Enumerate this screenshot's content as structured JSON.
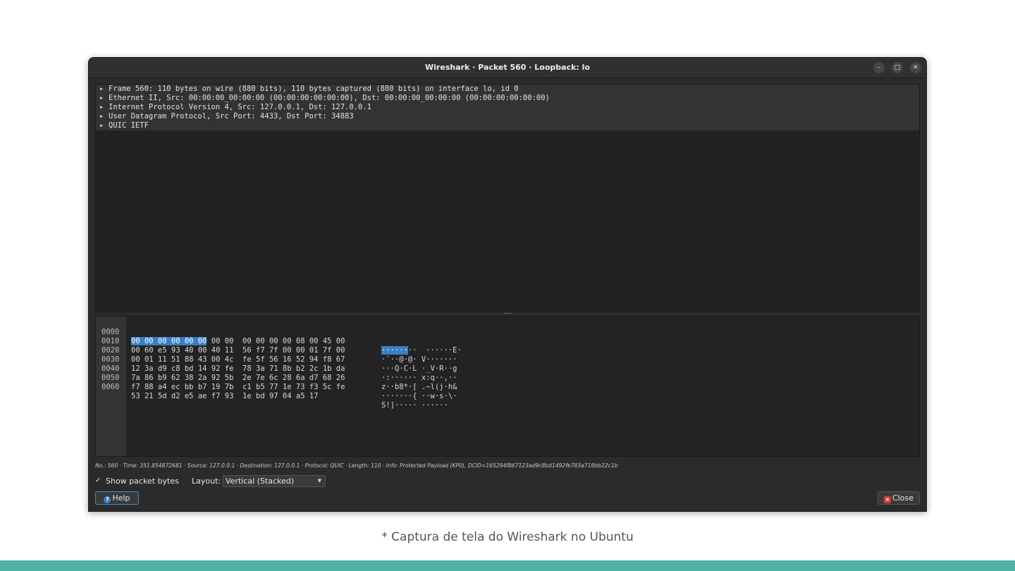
{
  "window": {
    "title": "Wireshark · Packet 560 · Loopback: lo",
    "controls": {
      "minimize": "–",
      "maximize": "□",
      "close": "✕"
    }
  },
  "tree": {
    "rows": [
      {
        "text": "Frame 560: 110 bytes on wire (880 bits), 110 bytes captured (880 bits) on interface lo, id 0"
      },
      {
        "text": "Ethernet II, Src: 00:00:00_00:00:00 (00:00:00:00:00:00), Dst: 00:00:00_00:00:00 (00:00:00:00:00:00)"
      },
      {
        "text": "Internet Protocol Version 4, Src: 127.0.0.1, Dst: 127.0.0.1"
      },
      {
        "text": "User Datagram Protocol, Src Port: 4433, Dst Port: 34883"
      },
      {
        "text": "QUIC IETF"
      }
    ]
  },
  "hex": {
    "lines": [
      {
        "offset": "0000",
        "hl_bytes": "00 00 00 00 00 00",
        "bytes": " 00 00  00 00 00 00 08 00 45 00",
        "hl_ascii": "······",
        "ascii": "··  ······E·"
      },
      {
        "offset": "0010",
        "hl_bytes": "",
        "bytes": "00 60 e5 93 40 00 40 11  56 f7 7f 00 00 01 7f 00",
        "hl_ascii": "",
        "ascii": "·`··@·@· V·······"
      },
      {
        "offset": "0020",
        "hl_bytes": "",
        "bytes": "00 01 11 51 88 43 00 4c  fe 5f 56 16 52 94 f8 67",
        "hl_ascii": "",
        "ascii": "···Q·C·L ·_V·R··g"
      },
      {
        "offset": "0030",
        "hl_bytes": "",
        "bytes": "12 3a d9 c8 bd 14 92 fe  78 3a 71 8b b2 2c 1b da",
        "hl_ascii": "",
        "ascii": "·:······ x:q··,··"
      },
      {
        "offset": "0040",
        "hl_bytes": "",
        "bytes": "7a 86 b9 62 38 2a 92 5b  2e 7e 6c 28 6a d7 68 26",
        "hl_ascii": "",
        "ascii": "z··b8*·[ .~l(j·h&"
      },
      {
        "offset": "0050",
        "hl_bytes": "",
        "bytes": "f7 88 a4 ec bb b7 19 7b  c1 b5 77 1e 73 f3 5c fe",
        "hl_ascii": "",
        "ascii": "·······{ ··w·s·\\·"
      },
      {
        "offset": "0060",
        "hl_bytes": "",
        "bytes": "53 21 5d d2 e5 ae f7 93  1e bd 97 04 a5 17",
        "hl_ascii": "",
        "ascii": "S!]····· ······"
      }
    ]
  },
  "status": {
    "text": "No.: 560 · Time: 351.854872681 · Source: 127.0.0.1 · Destination: 127.0.0.1 · Protocol: QUIC · Length: 110 · Info: Protected Payload (KP0), DCID=165294f867123ad9c8bd1492fe783a718bb22c1b"
  },
  "options": {
    "show_bytes_check": "✓",
    "show_bytes_label": "Show packet bytes",
    "layout_label": "Layout:",
    "layout_value": "Vertical (Stacked)"
  },
  "buttons": {
    "help_icon": "?",
    "help_label": "Help",
    "close_icon": "×",
    "close_label": "Close"
  },
  "caption": "* Captura de tela do Wireshark no Ubuntu",
  "colors": {
    "accent": "#3b7fc4",
    "bottom_bar": "#4fb3a5",
    "close_icon": "#d23b3b"
  }
}
